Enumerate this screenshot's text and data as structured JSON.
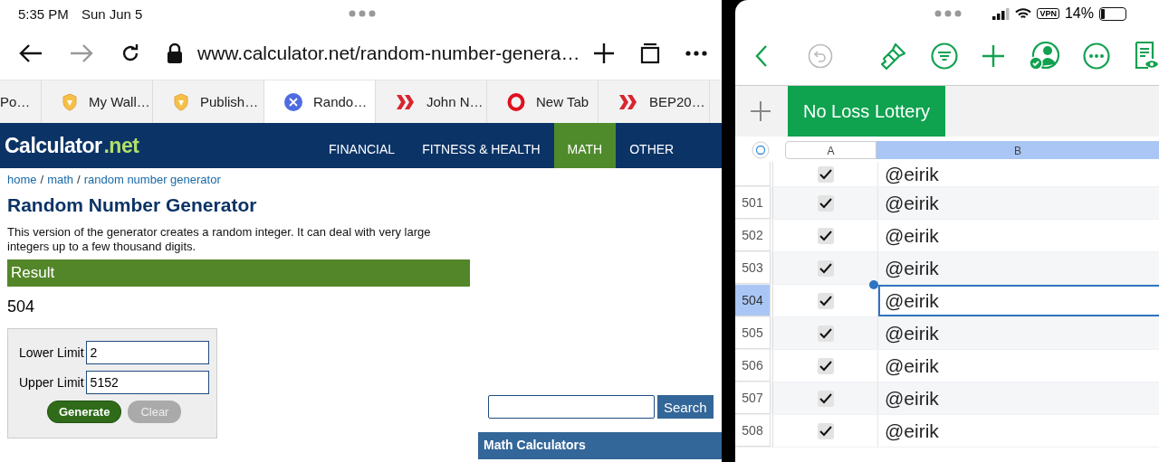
{
  "browser": {
    "status_bar": {
      "time": "5:35 PM",
      "date": "Sun Jun 5"
    },
    "toolbar": {
      "back_disabled": false,
      "forward_disabled": true,
      "url": "www.calculator.net/random-number-genera…"
    },
    "tabs": [
      {
        "title": "Po…",
        "selected": false
      },
      {
        "title": "My Wall…",
        "selected": false
      },
      {
        "title": "Publish…",
        "selected": false
      },
      {
        "title": "Rando…",
        "selected": true
      },
      {
        "title": "John N…",
        "selected": false
      },
      {
        "title": "New Tab",
        "selected": false
      },
      {
        "title": "BEP20…",
        "selected": false
      }
    ]
  },
  "site": {
    "logo_main": "Calculator",
    "logo_suffix": ".net",
    "nav": [
      {
        "label": "FINANCIAL",
        "selected": false
      },
      {
        "label": "FITNESS & HEALTH",
        "selected": false
      },
      {
        "label": "MATH",
        "selected": true
      },
      {
        "label": "OTHER",
        "selected": false
      }
    ],
    "breadcrumb": [
      {
        "kind": "link",
        "text": "home"
      },
      {
        "kind": "sep",
        "text": "/"
      },
      {
        "kind": "link",
        "text": "math"
      },
      {
        "kind": "sep",
        "text": "/"
      },
      {
        "kind": "link",
        "text": "random number generator"
      }
    ],
    "title": "Random Number Generator",
    "description": "This version of the generator creates a random integer. It can deal with very large integers up to a few thousand digits.",
    "result_heading": "Result",
    "result": "504",
    "form": {
      "fields": [
        {
          "label": "Lower Limit",
          "value": "2"
        },
        {
          "label": "Upper Limit",
          "value": "5152"
        }
      ],
      "buttons": [
        {
          "kind": "primary",
          "label": "Generate"
        },
        {
          "kind": "secondary",
          "label": "Clear"
        }
      ]
    },
    "search": {
      "button": "Search"
    },
    "sidebar_heading": "Math Calculators"
  },
  "sheet": {
    "status": {
      "vpn": "VPN",
      "battery": "14%"
    },
    "tabs": [
      {
        "label": "No Loss Lottery",
        "selected": true
      }
    ],
    "columns": [
      {
        "label": "A",
        "selected": false
      },
      {
        "label": "B",
        "selected": true
      }
    ],
    "rows": [
      {
        "checked": true,
        "value": "@eirik",
        "selected": false
      },
      {
        "number": "501",
        "checked": true,
        "value": "@eirik",
        "selected": false
      },
      {
        "number": "502",
        "checked": true,
        "value": "@eirik",
        "selected": false
      },
      {
        "number": "503",
        "checked": true,
        "value": "@eirik",
        "selected": false
      },
      {
        "number": "504",
        "checked": true,
        "value": "@eirik",
        "selected": true
      },
      {
        "number": "505",
        "checked": true,
        "value": "@eirik",
        "selected": false
      },
      {
        "number": "506",
        "checked": true,
        "value": "@eirik",
        "selected": false
      },
      {
        "number": "507",
        "checked": true,
        "value": "@eirik",
        "selected": false
      },
      {
        "number": "508",
        "checked": true,
        "value": "@eirik",
        "selected": false
      }
    ]
  }
}
